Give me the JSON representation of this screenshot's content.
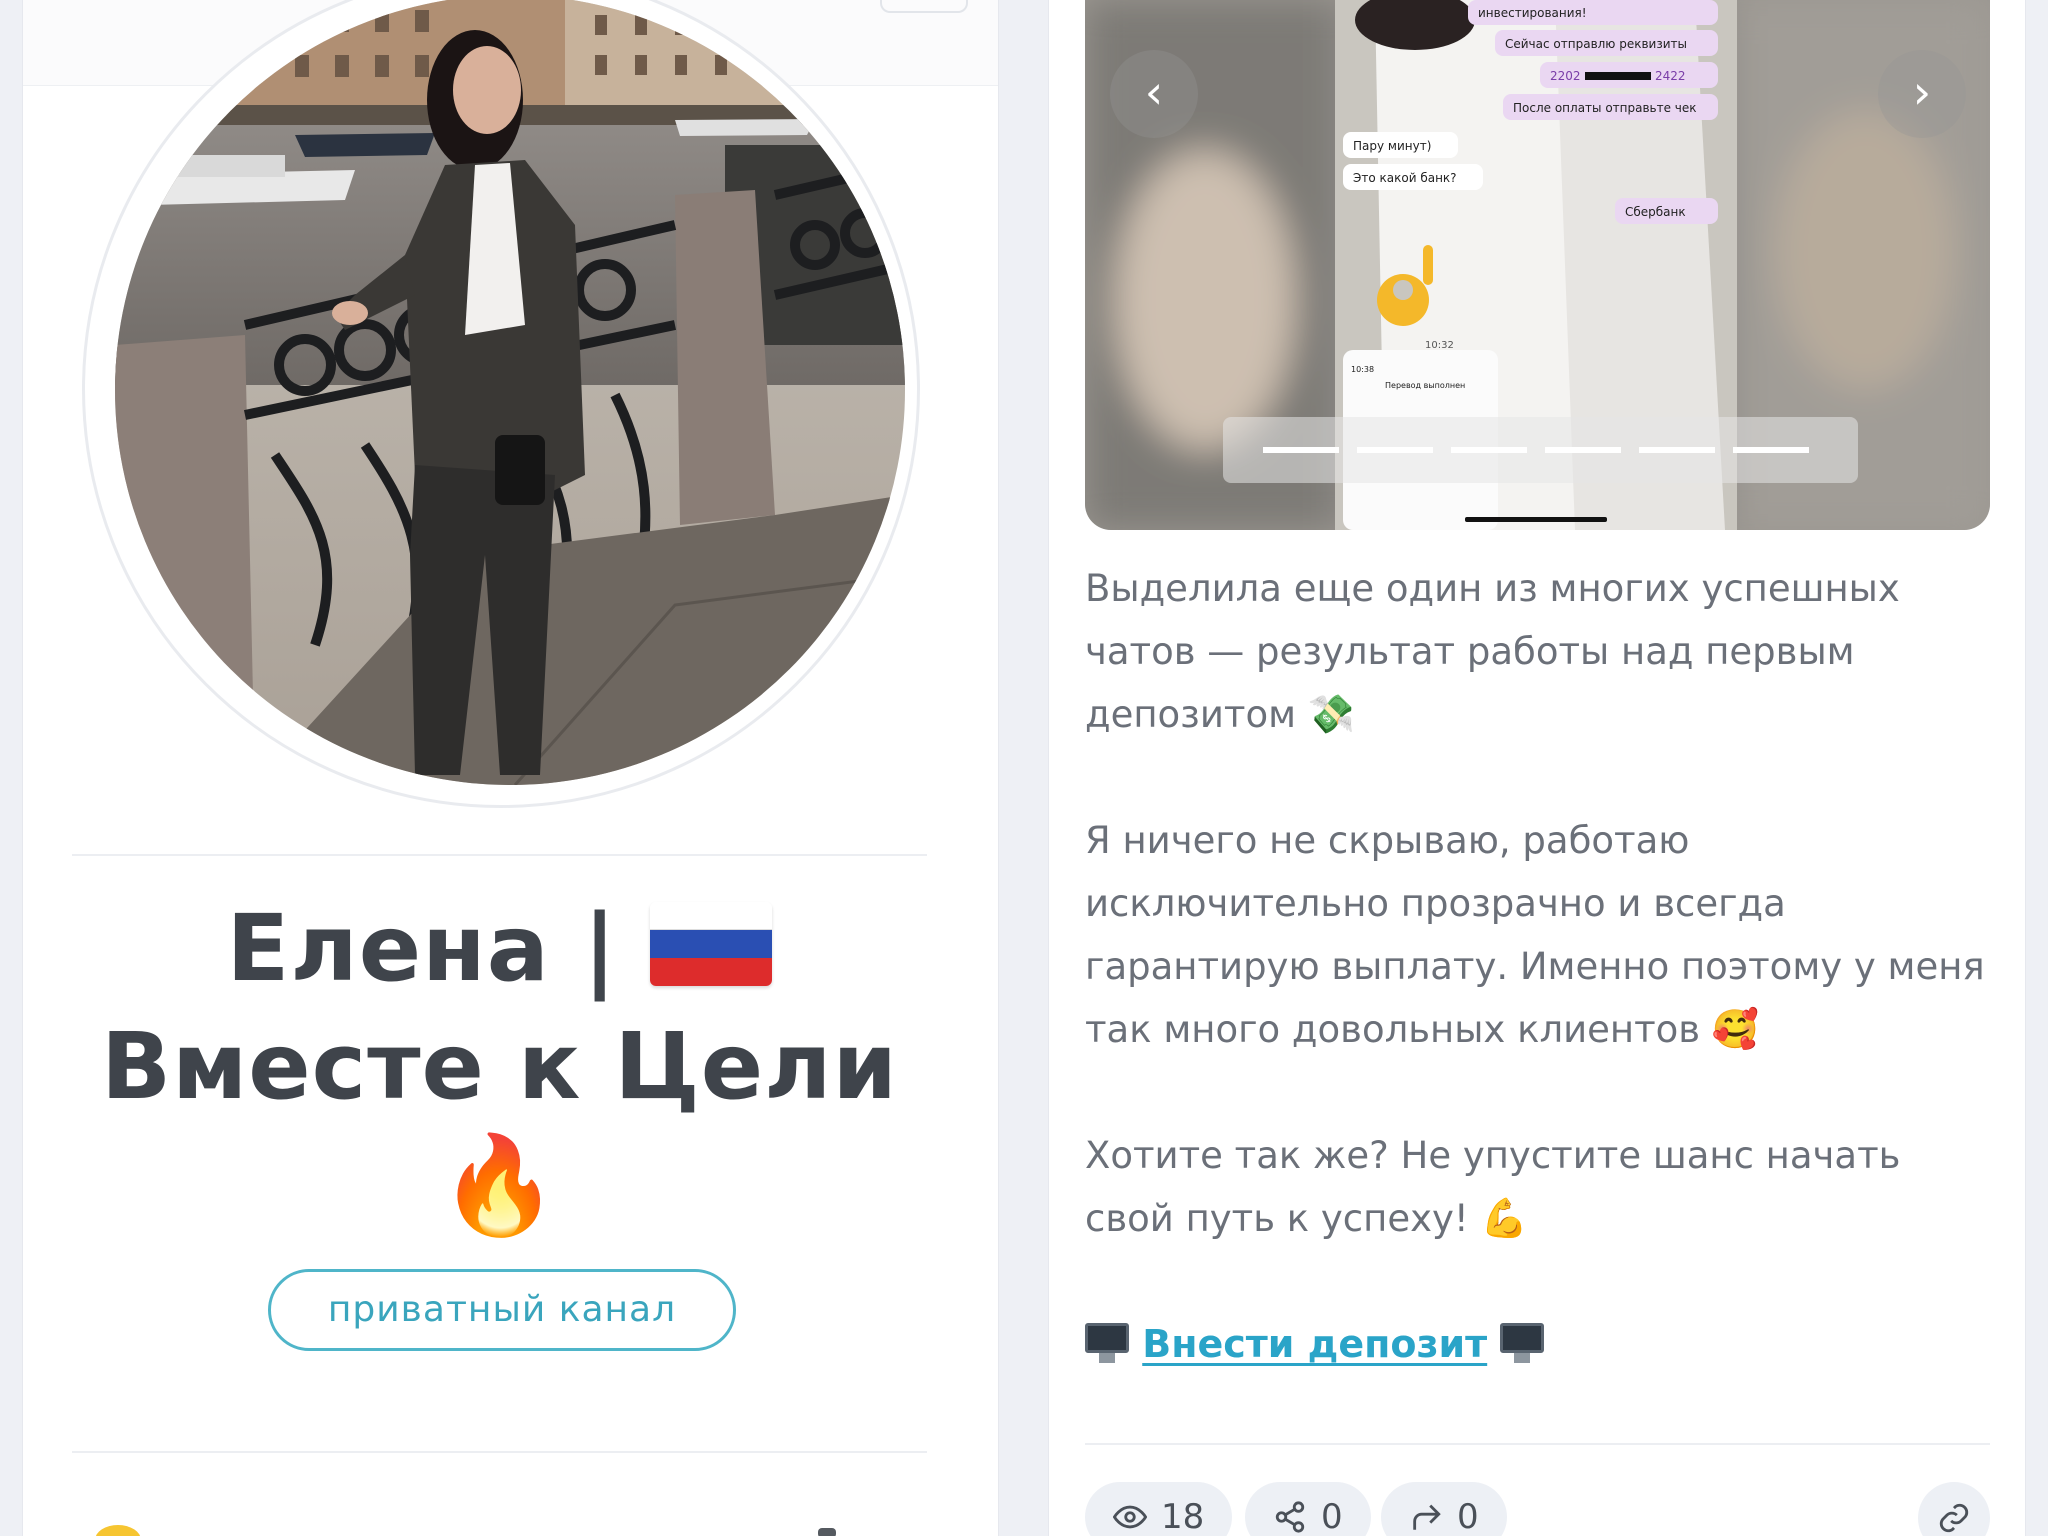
{
  "profile": {
    "title_line1": "Елена |",
    "title_line2": "Вместе к Цели",
    "private_channel_label": "приватный канал",
    "icons": [
      "russia-flag-icon",
      "fire-icon"
    ]
  },
  "post": {
    "carousel": {
      "prev_icon": "chevron-left-icon",
      "next_icon": "chevron-right-icon",
      "chat_messages": [
        "инвестирования!",
        "Сейчас отправлю реквизиты",
        "2202",
        "2422",
        "После оплаты отправьте чек",
        "Пару минут)",
        "Это какой банк?",
        "Сбербанк",
        "10:32",
        "10:38",
        "Перевод выполнен"
      ]
    },
    "paragraphs": [
      "Выделила еще один из многих успешных чатов — результат работы над первым депозитом",
      "Я ничего не скрываю, работаю исключительно прозрачно и всегда гарантирую выплату. Именно поэтому у меня так много довольных клиентов",
      "Хотите так же? Не упустите шанс начать свой путь к успеху!"
    ],
    "emojis": [
      "💸",
      "🥰",
      "💪"
    ],
    "deposit_link": "Внести депозит",
    "stats": {
      "views": "18",
      "shares": "0",
      "forwards": "0"
    }
  }
}
